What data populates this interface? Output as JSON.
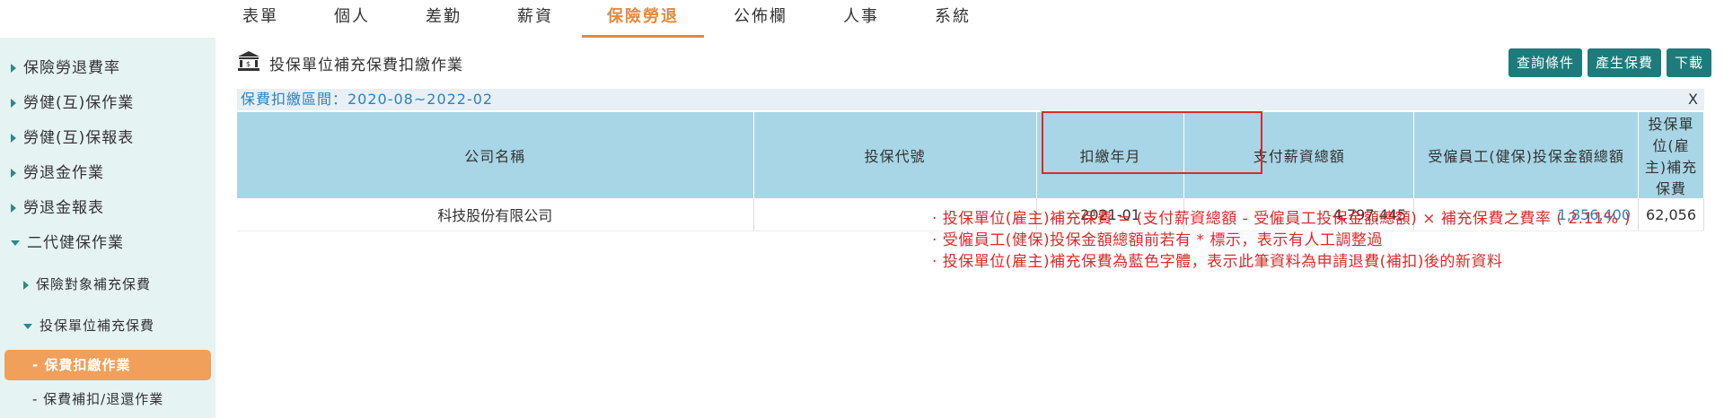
{
  "nav": {
    "items": [
      {
        "label": "表單"
      },
      {
        "label": "個人"
      },
      {
        "label": "差勤"
      },
      {
        "label": "薪資"
      },
      {
        "label": "保險勞退"
      },
      {
        "label": "公佈欄"
      },
      {
        "label": "人事"
      },
      {
        "label": "系統"
      }
    ],
    "active": "保險勞退"
  },
  "sidebar": {
    "items": [
      {
        "label": "保險勞退費率"
      },
      {
        "label": "勞健(互)保作業"
      },
      {
        "label": "勞健(互)保報表"
      },
      {
        "label": "勞退金作業"
      },
      {
        "label": "勞退金報表"
      },
      {
        "label": "二代健保作業"
      },
      {
        "label": "保險對象補充保費"
      },
      {
        "label": "投保單位補充保費"
      },
      {
        "label": "- 保費扣繳作業"
      },
      {
        "label": "- 保費補扣/退還作業"
      }
    ]
  },
  "page": {
    "title": "投保單位補充保費扣繳作業",
    "icon": "bank-icon",
    "buttons": {
      "query": "查詢條件",
      "generate": "產生保費",
      "download": "下載"
    },
    "range_label": "保費扣繳區間：2020-08~2022-02",
    "close_label": "X"
  },
  "table": {
    "headers": [
      "公司名稱",
      "投保代號",
      "扣繳年月",
      "支付薪資總額",
      "受僱員工(健保)投保金額總額",
      "投保單位(雇主)補充保費"
    ],
    "rows": [
      {
        "company": "科技股份有限公司",
        "code": "",
        "month": "2021-01",
        "salary_total": "4,797,445",
        "insured_total": "1,856,400",
        "supplement": "62,056"
      }
    ]
  },
  "notes": [
    "· 投保單位(雇主)補充保費 = (支付薪資總額 - 受僱員工投保金額總額) × 補充保費之費率 ( 2.11% )",
    "· 受僱員工(健保)投保金額總額前若有 * 標示，表示有人工調整過",
    "· 投保單位(雇主)補充保費為藍色字體，表示此筆資料為申請退費(補扣)後的新資料"
  ],
  "colors": {
    "accent": "#e8893a",
    "sidebar_bg": "#e6f3f3",
    "selected_bg": "#f0a05a",
    "button_bg": "#1e7b7b",
    "table_header_bg": "#a8d6e6",
    "link_blue": "#2a84c2",
    "note_red": "#d92b2b"
  }
}
